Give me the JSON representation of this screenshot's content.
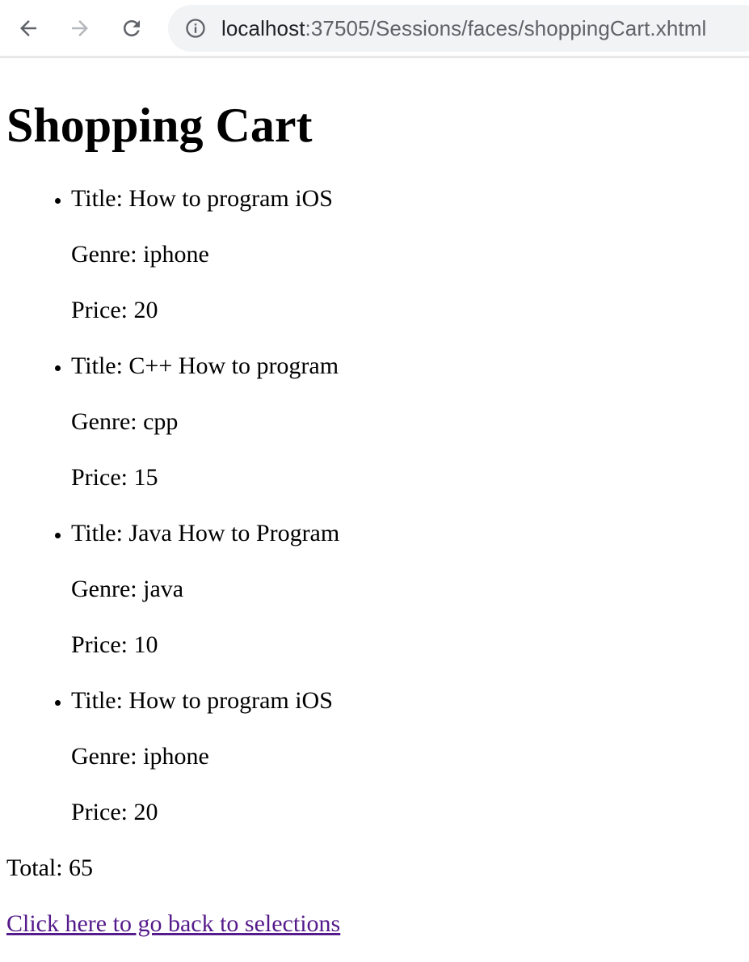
{
  "browser": {
    "url_host": "localhost",
    "url_path": ":37505/Sessions/faces/shoppingCart.xhtml",
    "icons": {
      "back": "back-arrow-icon",
      "forward": "forward-arrow-icon",
      "reload": "reload-icon",
      "site_info": "info-icon"
    }
  },
  "page": {
    "title": "Shopping Cart",
    "items": [
      {
        "title": "Title: How to program iOS",
        "genre": "Genre: iphone",
        "price": "Price: 20"
      },
      {
        "title": "Title: C++ How to program",
        "genre": "Genre: cpp",
        "price": "Price: 15"
      },
      {
        "title": "Title: Java How to Program",
        "genre": "Genre: java",
        "price": "Price: 10"
      },
      {
        "title": "Title: How to program iOS",
        "genre": "Genre: iphone",
        "price": "Price: 20"
      }
    ],
    "total": "Total: 65",
    "back_link": "Click here to go back to selections"
  },
  "colors": {
    "visited_link": "#551a8b",
    "omnibox_bg": "#f1f3f4",
    "toolbar_icon": "#5f6368",
    "toolbar_icon_disabled": "#b4b7bb"
  }
}
